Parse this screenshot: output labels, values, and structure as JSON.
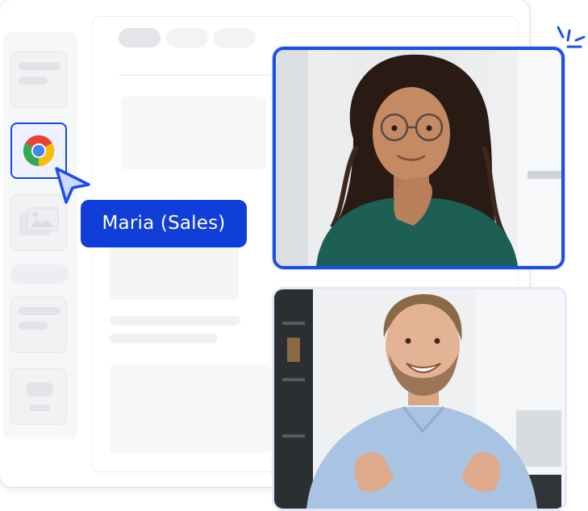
{
  "call": {
    "presenter_label": "Maria (Sales)"
  },
  "sidebar": {
    "items": [
      {
        "icon": "placeholder-icon"
      },
      {
        "icon": "chrome-icon",
        "active": true
      },
      {
        "icon": "gallery-icon"
      },
      {
        "icon": "placeholder-icon"
      },
      {
        "icon": "placeholder-icon"
      }
    ]
  },
  "participants": [
    {
      "role": "presenter",
      "speaking": true,
      "highlight_color": "#1a4ee8"
    },
    {
      "role": "participant",
      "speaking": false
    }
  ],
  "colors": {
    "accent": "#0f3ed8",
    "tile_border": "#1a4ee8"
  }
}
